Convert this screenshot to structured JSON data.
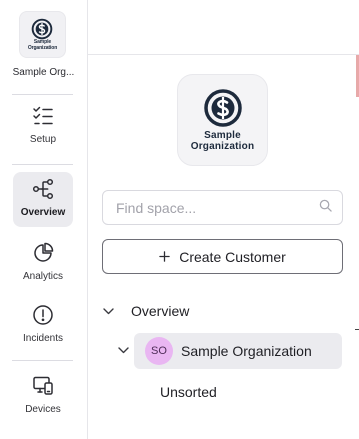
{
  "sidebar": {
    "org": {
      "logo_line1": "Sample",
      "logo_line2": "Organization",
      "name": "Sample Org..."
    },
    "items": [
      {
        "label": "Setup",
        "icon": "checklist-icon"
      },
      {
        "label": "Overview",
        "icon": "hierarchy-icon",
        "active": true
      },
      {
        "label": "Analytics",
        "icon": "pie-chart-icon"
      },
      {
        "label": "Incidents",
        "icon": "alert-circle-icon"
      },
      {
        "label": "Devices",
        "icon": "devices-icon"
      }
    ]
  },
  "main": {
    "logo": {
      "line1": "Sample",
      "line2": "Organization"
    },
    "search": {
      "placeholder": "Find space..."
    },
    "create_button": {
      "label": "Create Customer"
    },
    "tree": {
      "root": {
        "label": "Overview"
      },
      "org": {
        "initials": "SO",
        "label": "Sample Organization"
      },
      "unsorted": {
        "label": "Unsorted"
      }
    }
  },
  "colors": {
    "active_bg": "#ebebef",
    "avatar_bg": "#e9b6f2",
    "logo_navy": "#1d2a3c"
  }
}
